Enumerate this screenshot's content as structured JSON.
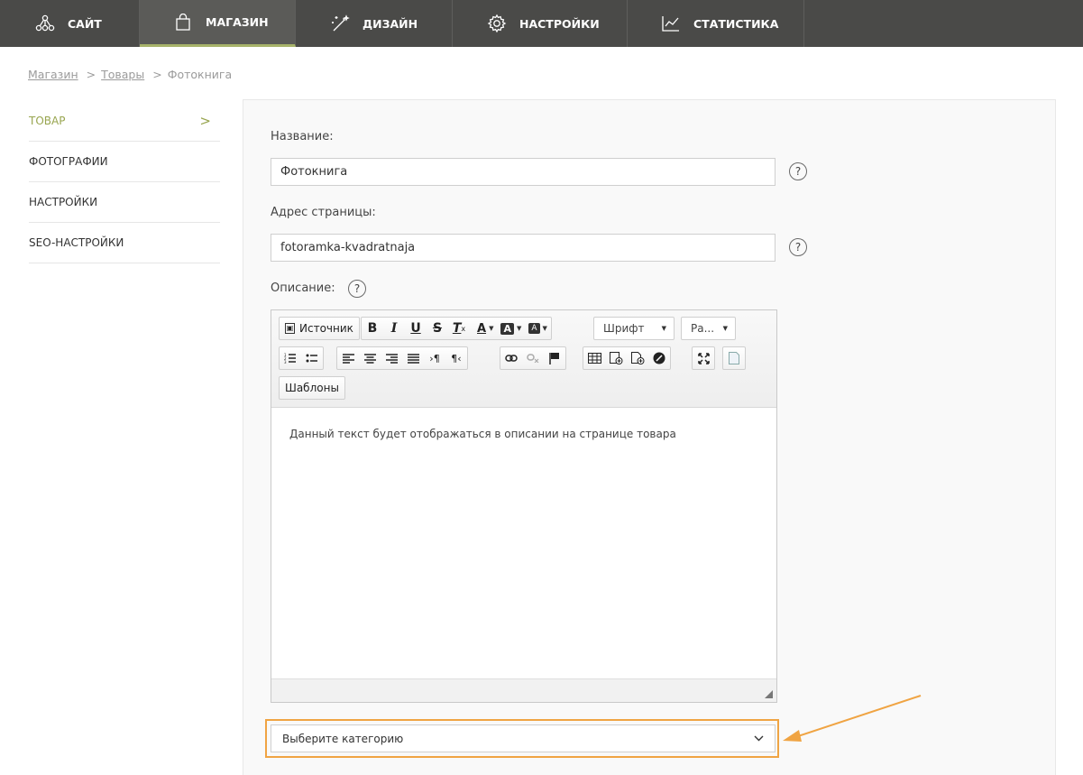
{
  "nav": {
    "items": [
      {
        "label": "САЙТ",
        "icon": "sitemap-icon"
      },
      {
        "label": "МАГАЗИН",
        "icon": "shopping-bag-icon"
      },
      {
        "label": "ДИЗАЙН",
        "icon": "magic-wand-icon"
      },
      {
        "label": "НАСТРОЙКИ",
        "icon": "gear-icon"
      },
      {
        "label": "СТАТИСТИКА",
        "icon": "line-chart-icon"
      }
    ],
    "active": "МАГАЗИН"
  },
  "breadcrumb": {
    "items": [
      "Магазин",
      "Товары",
      "Фотокнига"
    ],
    "separator": ">"
  },
  "sidebar": {
    "items": [
      {
        "label": "ТОВАР",
        "active": true
      },
      {
        "label": "ФОТОГРАФИИ"
      },
      {
        "label": "НАСТРОЙКИ"
      },
      {
        "label": "SEO-НАСТРОЙКИ"
      }
    ],
    "chevron": ">"
  },
  "form": {
    "name_label": "Название:",
    "name_value": "Фотокнига",
    "url_label": "Адрес страницы:",
    "url_value": "fotoramka-kvadratnaja",
    "desc_label": "Описание:",
    "help": "?"
  },
  "editor": {
    "source_label": "Источник",
    "bold": "B",
    "italic": "I",
    "underline": "U",
    "strike": "S",
    "font_combo": "Шрифт",
    "size_combo": "Ра...",
    "templates_label": "Шаблоны",
    "content": "Данный текст будет отображаться в описании на странице товара"
  },
  "category": {
    "placeholder": "Выберите категорию"
  },
  "colors": {
    "nav_bg": "#4a4a48",
    "accent": "#98a54f",
    "highlight": "#f0a443"
  }
}
